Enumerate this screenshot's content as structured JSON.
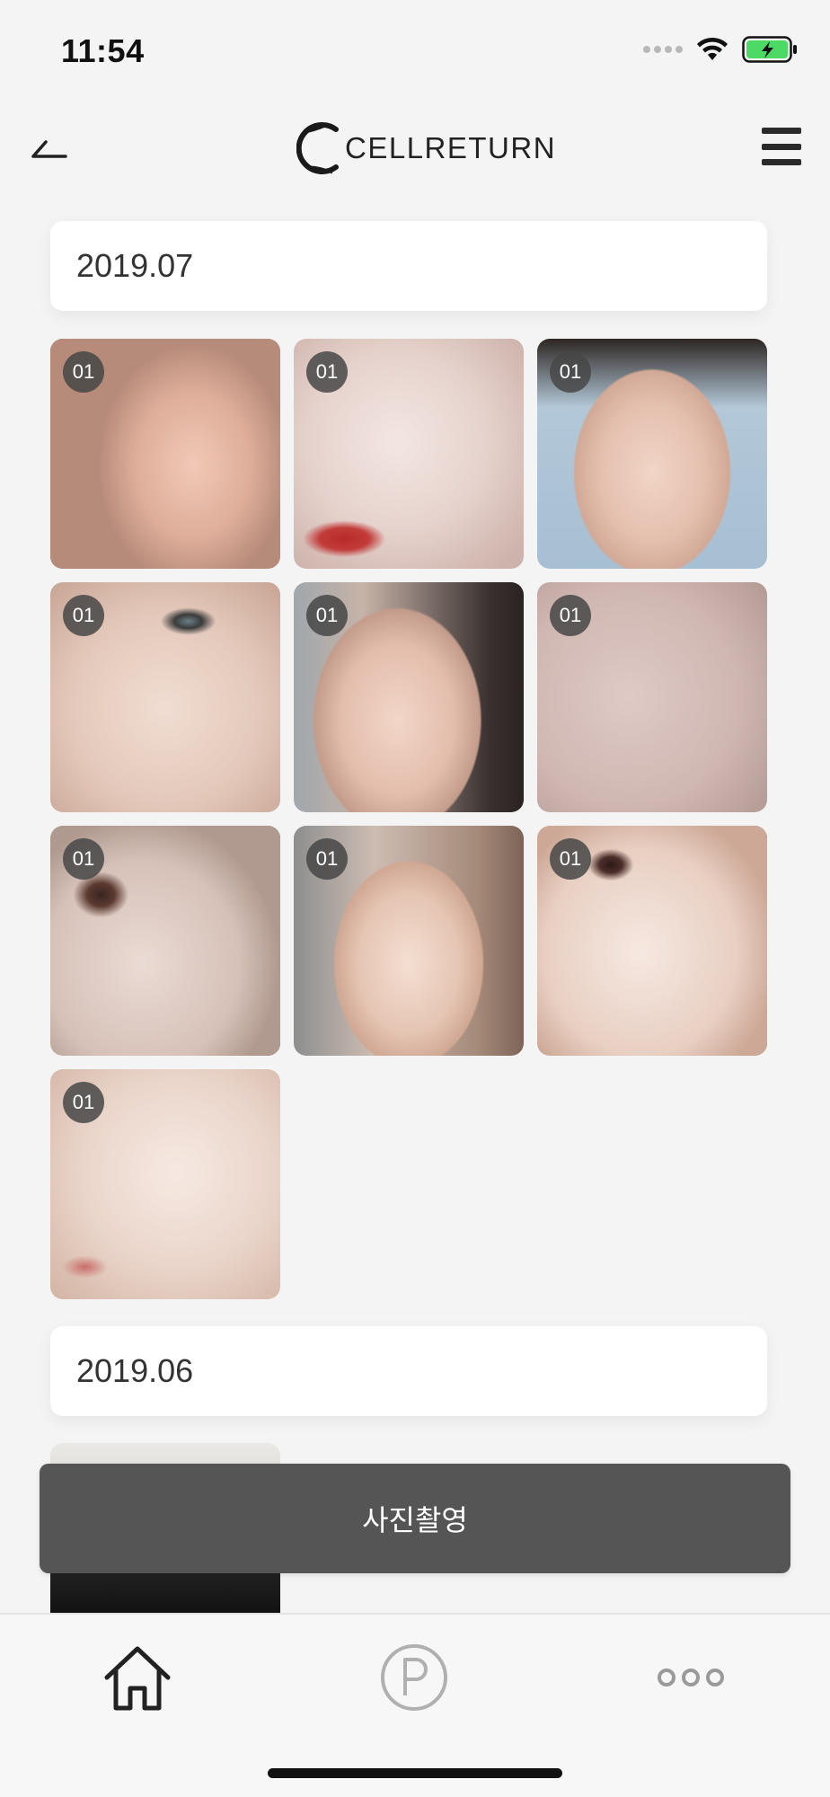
{
  "status_bar": {
    "time": "11:54"
  },
  "header": {
    "logo_text": "CELLRETURN"
  },
  "sections": [
    {
      "date": "2019.07",
      "photos": [
        {
          "badge": "01"
        },
        {
          "badge": "01"
        },
        {
          "badge": "01"
        },
        {
          "badge": "01"
        },
        {
          "badge": "01"
        },
        {
          "badge": "01"
        },
        {
          "badge": "01"
        },
        {
          "badge": "01"
        },
        {
          "badge": "01"
        },
        {
          "badge": "01"
        }
      ]
    },
    {
      "date": "2019.06"
    }
  ],
  "floating_button": {
    "label": "사진촬영"
  },
  "tab_bar": {
    "tabs": [
      "home-icon",
      "points-icon",
      "more-icon"
    ]
  },
  "colors": {
    "button_bg": "#555555",
    "page_bg": "#f4f4f4",
    "badge_bg": "#464646",
    "battery_green": "#4cd964"
  }
}
